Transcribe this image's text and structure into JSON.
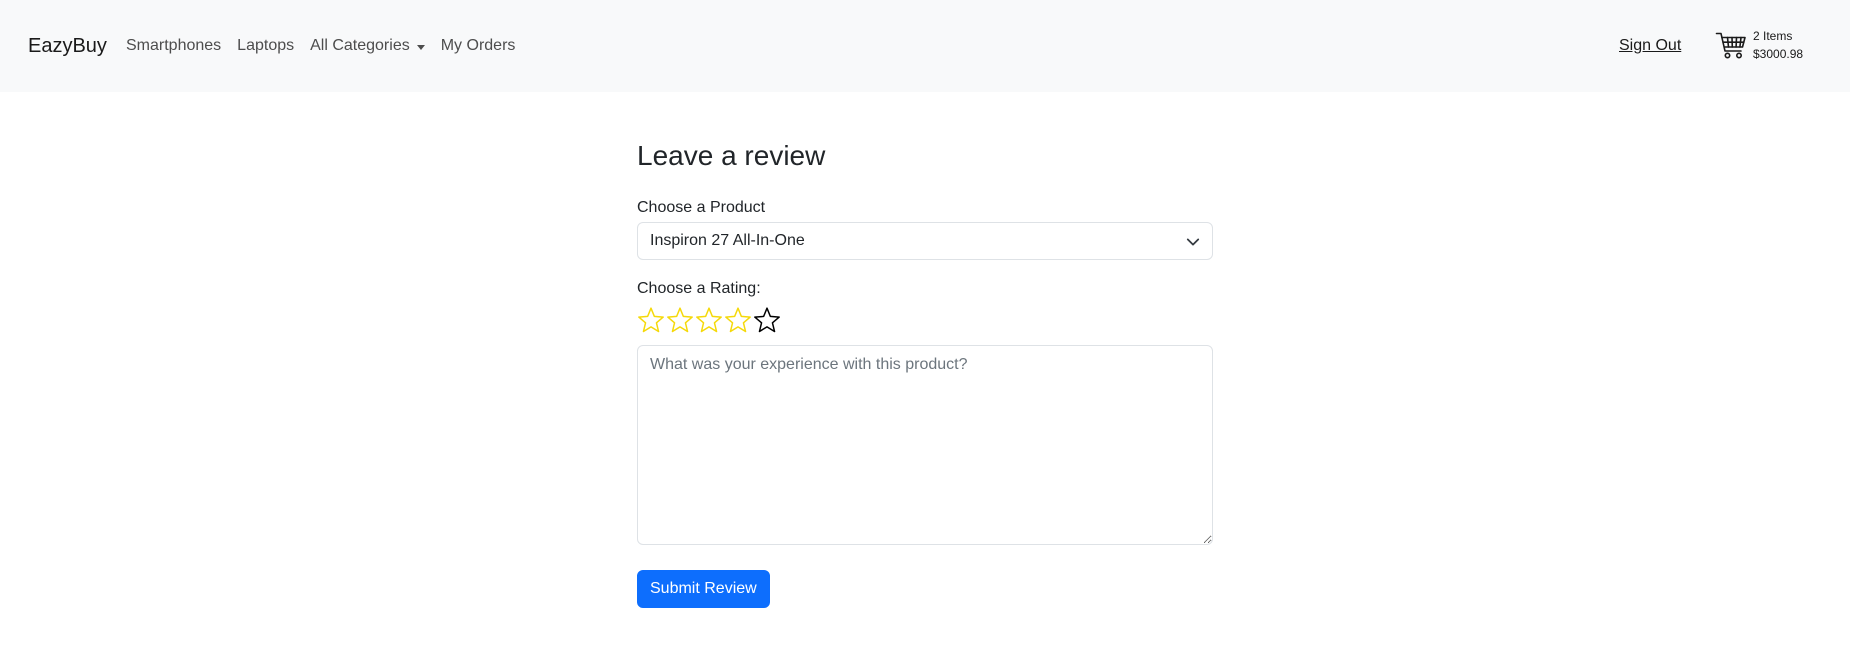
{
  "navbar": {
    "brand": "EazyBuy",
    "links": [
      "Smartphones",
      "Laptops",
      "All Categories",
      "My Orders"
    ],
    "sign_out": "Sign Out",
    "cart": {
      "icon": "shopping-cart-icon",
      "items": "2 Items",
      "total": "$3000.98"
    }
  },
  "review": {
    "title": "Leave a review",
    "product_label": "Choose a Product",
    "product_selected": "Inspiron 27 All-In-One",
    "rating_label": "Choose a Rating:",
    "rating_max": 5,
    "rating_highlighted": 4,
    "textarea_value": "",
    "textarea_placeholder": "What was your experience with this product?",
    "submit_label": "Submit Review"
  },
  "colors": {
    "navbar_bg": "#f8f9fa",
    "primary": "#0d6efd",
    "star_highlight": "#f5d90a",
    "star_outline": "#000000"
  }
}
